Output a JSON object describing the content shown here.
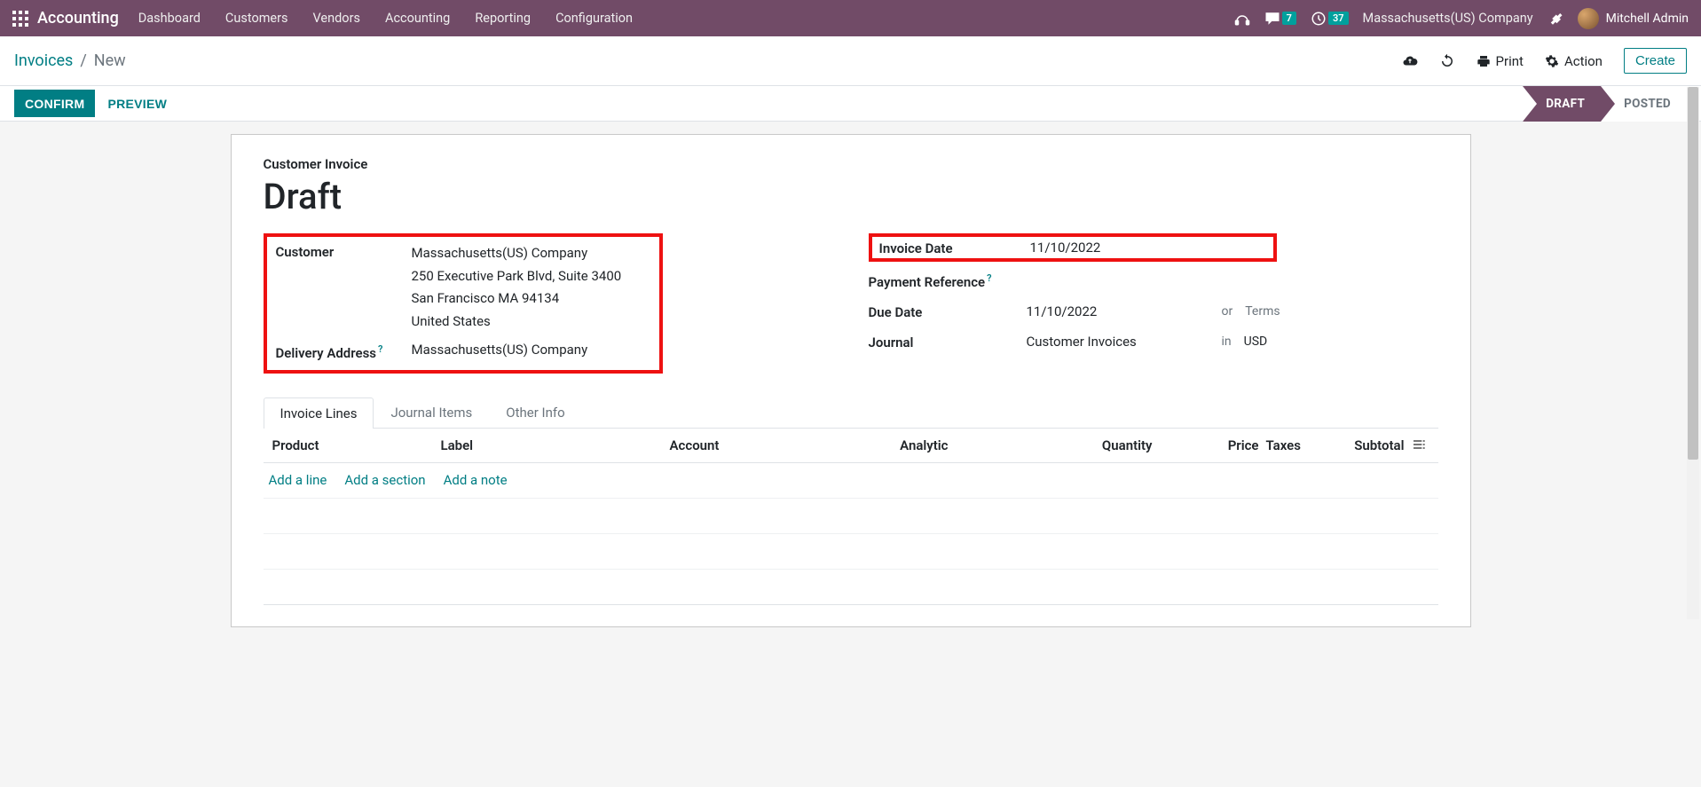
{
  "navbar": {
    "brand": "Accounting",
    "menu": [
      "Dashboard",
      "Customers",
      "Vendors",
      "Accounting",
      "Reporting",
      "Configuration"
    ],
    "messages_badge": "7",
    "activities_badge": "37",
    "company": "Massachusetts(US) Company",
    "user": "Mitchell Admin"
  },
  "controlbar": {
    "breadcrumb_root": "Invoices",
    "breadcrumb_sep": "/",
    "breadcrumb_current": "New",
    "print": "Print",
    "action": "Action",
    "create": "Create"
  },
  "actionbar": {
    "confirm": "CONFIRM",
    "preview": "PREVIEW",
    "status_draft": "DRAFT",
    "status_posted": "POSTED"
  },
  "form": {
    "subtitle": "Customer Invoice",
    "title": "Draft",
    "left": {
      "customer_label": "Customer",
      "customer_name": "Massachusetts(US) Company",
      "customer_addr1": "250 Executive Park Blvd, Suite 3400",
      "customer_addr2": "San Francisco MA 94134",
      "customer_addr3": "United States",
      "delivery_label": "Delivery Address",
      "delivery_value": "Massachusetts(US) Company"
    },
    "right": {
      "invoice_date_label": "Invoice Date",
      "invoice_date_value": "11/10/2022",
      "payment_ref_label": "Payment Reference",
      "payment_ref_value": "",
      "due_date_label": "Due Date",
      "due_date_value": "11/10/2022",
      "due_date_or": "or",
      "due_date_terms_placeholder": "Terms",
      "journal_label": "Journal",
      "journal_value": "Customer Invoices",
      "journal_in": "in",
      "journal_currency": "USD"
    }
  },
  "tabs": {
    "t1": "Invoice Lines",
    "t2": "Journal Items",
    "t3": "Other Info"
  },
  "grid": {
    "headers": {
      "product": "Product",
      "label": "Label",
      "account": "Account",
      "analytic": "Analytic",
      "quantity": "Quantity",
      "price": "Price",
      "taxes": "Taxes",
      "subtotal": "Subtotal"
    },
    "add_line": "Add a line",
    "add_section": "Add a section",
    "add_note": "Add a note"
  }
}
